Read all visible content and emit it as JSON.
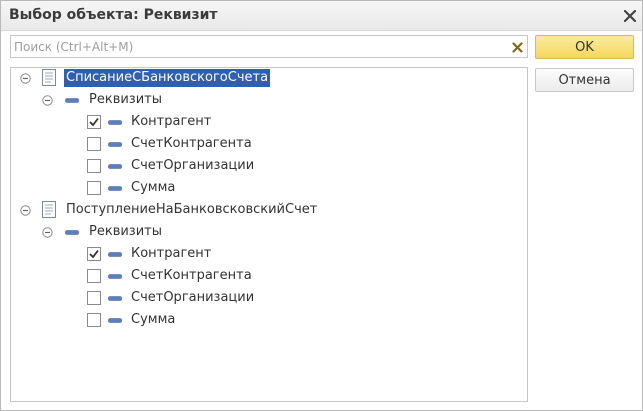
{
  "window": {
    "title": "Выбор объекта: Реквизит"
  },
  "search": {
    "placeholder": "Поиск (Ctrl+Alt+M)",
    "value": ""
  },
  "buttons": {
    "ok": "OK",
    "cancel": "Отмена"
  },
  "tree": [
    {
      "label": "СписаниеСБанковскогоСчета",
      "selected": true,
      "group": {
        "label": "Реквизиты",
        "items": [
          {
            "label": "Контрагент",
            "checked": true
          },
          {
            "label": "СчетКонтрагента",
            "checked": false
          },
          {
            "label": "СчетОрганизации",
            "checked": false
          },
          {
            "label": "Сумма",
            "checked": false
          }
        ]
      }
    },
    {
      "label": "ПоступлениеНаБанковсковскийСчет",
      "selected": false,
      "group": {
        "label": "Реквизиты",
        "items": [
          {
            "label": "Контрагент",
            "checked": true
          },
          {
            "label": "СчетКонтрагента",
            "checked": false
          },
          {
            "label": "СчетОрганизации",
            "checked": false
          },
          {
            "label": "Сумма",
            "checked": false
          }
        ]
      }
    }
  ],
  "colors": {
    "selection": "#2f5fb3",
    "ok_button": "#f4d75b",
    "dash_icon": "#5a7fc0"
  },
  "icons": {
    "collapse": "minus-circle-icon",
    "document": "document-icon",
    "attribute": "dash-icon",
    "close": "close-icon",
    "clear": "clear-x-icon"
  }
}
